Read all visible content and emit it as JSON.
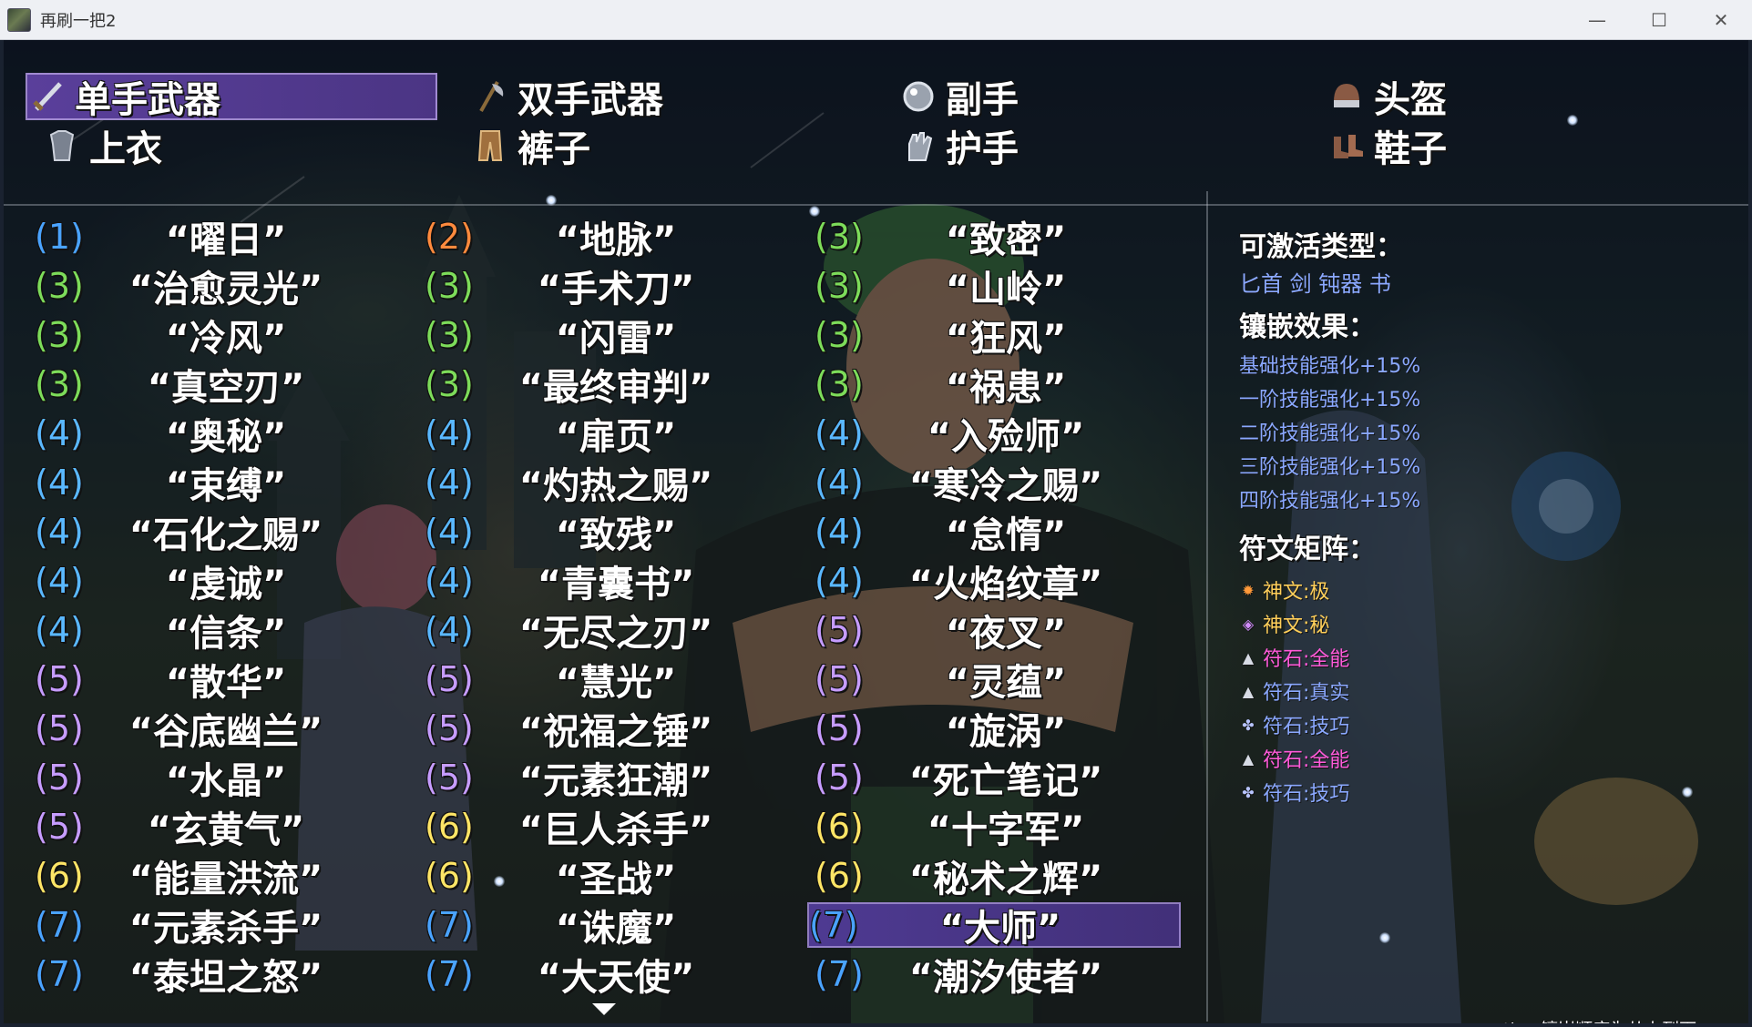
{
  "window": {
    "title": "再刷一把2",
    "controls": [
      "minimize-icon",
      "maximize-icon",
      "close-icon"
    ]
  },
  "categories": [
    {
      "label": "单手武器",
      "icon": "dagger-icon",
      "selected": true
    },
    {
      "label": "双手武器",
      "icon": "axe-icon",
      "selected": false
    },
    {
      "label": "副手",
      "icon": "orb-icon",
      "selected": false
    },
    {
      "label": "头盔",
      "icon": "helmet-icon",
      "selected": false
    },
    {
      "label": "上衣",
      "icon": "armor-icon",
      "selected": false
    },
    {
      "label": "裤子",
      "icon": "pants-icon",
      "selected": false
    },
    {
      "label": "护手",
      "icon": "gauntlet-icon",
      "selected": false
    },
    {
      "label": "鞋子",
      "icon": "boots-icon",
      "selected": false
    }
  ],
  "level_colors": {
    "1": "#4aa3ff",
    "2": "#ff8a3d",
    "3": "#7ddc5a",
    "4": "#5ab8ff",
    "5": "#c69cff",
    "6": "#ffe566",
    "7": "#4aa3ff"
  },
  "columns": [
    [
      {
        "level": "(1)",
        "name": "“曜日”"
      },
      {
        "level": "(3)",
        "name": "“治愈灵光”"
      },
      {
        "level": "(3)",
        "name": "“冷风”"
      },
      {
        "level": "(3)",
        "name": "“真空刃”"
      },
      {
        "level": "(4)",
        "name": "“奥秘”"
      },
      {
        "level": "(4)",
        "name": "“束缚”"
      },
      {
        "level": "(4)",
        "name": "“石化之赐”"
      },
      {
        "level": "(4)",
        "name": "“虔诚”"
      },
      {
        "level": "(4)",
        "name": "“信条”"
      },
      {
        "level": "(5)",
        "name": "“散华”"
      },
      {
        "level": "(5)",
        "name": "“谷底幽兰”"
      },
      {
        "level": "(5)",
        "name": "“水晶”"
      },
      {
        "level": "(5)",
        "name": "“玄黄气”"
      },
      {
        "level": "(6)",
        "name": "“能量洪流”"
      },
      {
        "level": "(7)",
        "name": "“元素杀手”"
      },
      {
        "level": "(7)",
        "name": "“泰坦之怒”"
      }
    ],
    [
      {
        "level": "(2)",
        "name": "“地脉”"
      },
      {
        "level": "(3)",
        "name": "“手术刀”"
      },
      {
        "level": "(3)",
        "name": "“闪雷”"
      },
      {
        "level": "(3)",
        "name": "“最终审判”"
      },
      {
        "level": "(4)",
        "name": "“扉页”"
      },
      {
        "level": "(4)",
        "name": "“灼热之赐”"
      },
      {
        "level": "(4)",
        "name": "“致残”"
      },
      {
        "level": "(4)",
        "name": "“青囊书”"
      },
      {
        "level": "(4)",
        "name": "“无尽之刃”"
      },
      {
        "level": "(5)",
        "name": "“慧光”"
      },
      {
        "level": "(5)",
        "name": "“祝福之锤”"
      },
      {
        "level": "(5)",
        "name": "“元素狂潮”"
      },
      {
        "level": "(6)",
        "name": "“巨人杀手”"
      },
      {
        "level": "(6)",
        "name": "“圣战”"
      },
      {
        "level": "(7)",
        "name": "“诛魔”"
      },
      {
        "level": "(7)",
        "name": "“大天使”"
      }
    ],
    [
      {
        "level": "(3)",
        "name": "“致密”"
      },
      {
        "level": "(3)",
        "name": "“山岭”"
      },
      {
        "level": "(3)",
        "name": "“狂风”"
      },
      {
        "level": "(3)",
        "name": "“祸患”"
      },
      {
        "level": "(4)",
        "name": "“入殓师”"
      },
      {
        "level": "(4)",
        "name": "“寒冷之赐”"
      },
      {
        "level": "(4)",
        "name": "“怠惰”"
      },
      {
        "level": "(4)",
        "name": "“火焰纹章”"
      },
      {
        "level": "(5)",
        "name": "“夜叉”"
      },
      {
        "level": "(5)",
        "name": "“灵蕴”"
      },
      {
        "level": "(5)",
        "name": "“旋涡”"
      },
      {
        "level": "(5)",
        "name": "“死亡笔记”"
      },
      {
        "level": "(6)",
        "name": "“十字军”"
      },
      {
        "level": "(6)",
        "name": "“秘术之辉”"
      },
      {
        "level": "(7)",
        "name": "“大师”",
        "selected": true
      },
      {
        "level": "(7)",
        "name": "“潮汐使者”"
      }
    ]
  ],
  "info": {
    "activatable_title": "可激活类型：",
    "activatable_types": "匕首 剑 钝器 书",
    "effects_title": "镶嵌效果：",
    "effects": [
      "基础技能强化+15%",
      "一阶技能强化+15%",
      "二阶技能强化+15%",
      "三阶技能强化+15%",
      "四阶技能强化+15%"
    ],
    "runes_title": "符文矩阵：",
    "runes": [
      {
        "text": "神文:极",
        "color": "#ffcf5a",
        "icon": "sun-rune-icon"
      },
      {
        "text": "神文:秘",
        "color": "#ffcf5a",
        "icon": "purple-rune-icon"
      },
      {
        "text": "符石:全能",
        "color": "#ff5ad9",
        "icon": "triangle-stone-icon"
      },
      {
        "text": "符石:真实",
        "color": "#8aa8ff",
        "icon": "triangle-stone-icon"
      },
      {
        "text": "符石:技巧",
        "color": "#8aa8ff",
        "icon": "clover-stone-icon"
      },
      {
        "text": "符石:全能",
        "color": "#ff5ad9",
        "icon": "triangle-stone-icon"
      },
      {
        "text": "符石:技巧",
        "color": "#8aa8ff",
        "icon": "clover-stone-icon"
      }
    ]
  },
  "tips": "tips:镶嵌顺序为从上到下"
}
